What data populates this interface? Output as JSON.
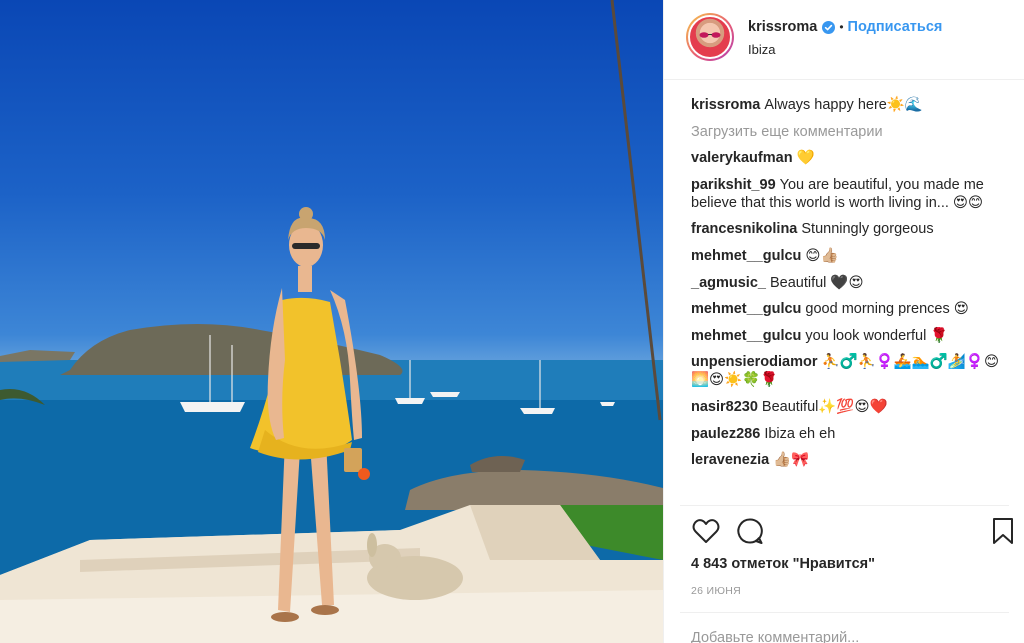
{
  "post": {
    "image_alt": "Woman in yellow dress standing on stone steps by the sea in Ibiza"
  },
  "header": {
    "username": "krissroma",
    "separator": "•",
    "follow_label": "Подписаться",
    "location": "Ibiza"
  },
  "caption": {
    "user": "krissroma",
    "text": "Always happy here☀️🌊"
  },
  "load_more_label": "Загрузить еще комментарии",
  "comments": [
    {
      "user": "valerykaufman",
      "text": "💛"
    },
    {
      "user": "parikshit_99",
      "text": "You are beautiful, you made me believe that this world is worth living in... 😍😊"
    },
    {
      "user": "francesnikolina",
      "text": "Stunningly gorgeous"
    },
    {
      "user": "mehmet__gulcu",
      "text": "😊👍🏼"
    },
    {
      "user": "_agmusic_",
      "text": "Beautiful 🖤😍"
    },
    {
      "user": "mehmet__gulcu",
      "text": "good morning prences 😍"
    },
    {
      "user": "mehmet__gulcu",
      "text": "you look wonderful 🌹"
    },
    {
      "user": "unpensierodiamor",
      "text": "⛹♂️⛹♀️🚣🏊♂️🏄♀️😊🌅😍☀️🍀🌹"
    },
    {
      "user": "nasir8230",
      "text": "Beautiful✨💯😍❤️"
    },
    {
      "user": "paulez286",
      "text": "Ibiza eh eh"
    },
    {
      "user": "leravenezia",
      "text": "👍🏼🎀"
    }
  ],
  "likes_text": "4 843 отметок \"Нравится\"",
  "date_text": "26 ИЮНЯ",
  "comment_placeholder": "Добавьте комментарий...",
  "colors": {
    "accent": "#3897f0",
    "text": "#262626",
    "muted": "#999999",
    "border": "#efefef"
  }
}
